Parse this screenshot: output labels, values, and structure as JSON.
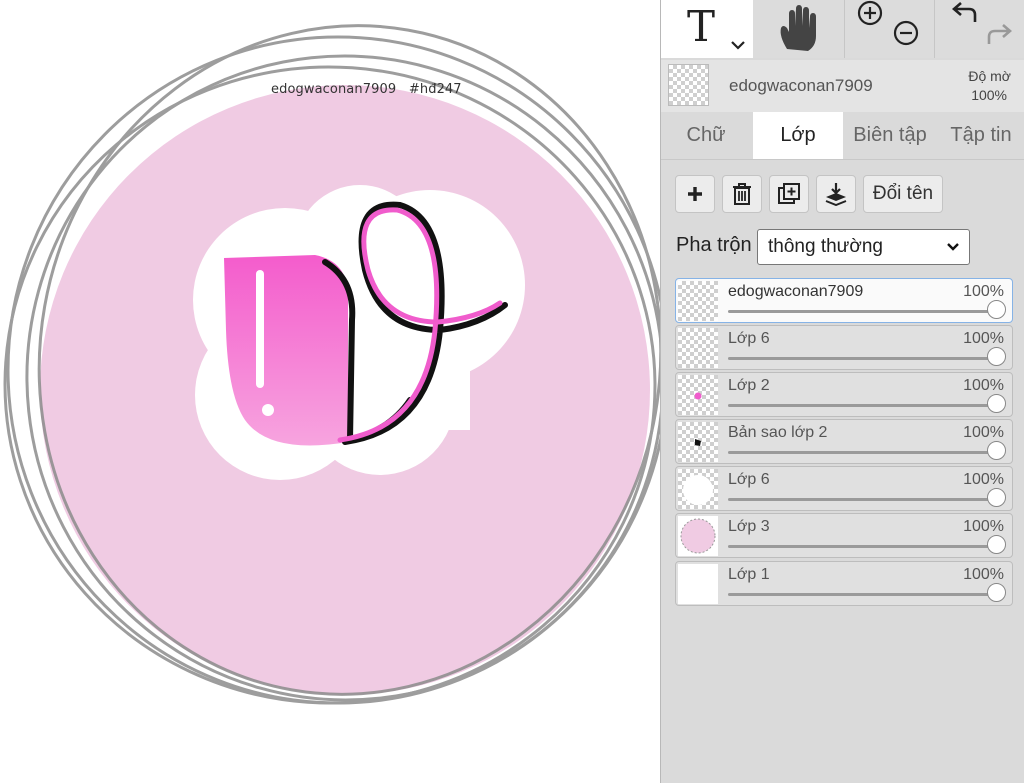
{
  "canvas": {
    "label": "edogwaconan7909   #hđ247",
    "colors": {
      "circle": "#f0cbe3",
      "ring": "#8c8c8c",
      "letter": "#f05ccc",
      "outline": "#111111"
    }
  },
  "toolbar": {
    "tools": [
      {
        "name": "text-tool",
        "glyph": "T",
        "active": true
      },
      {
        "name": "hand-tool",
        "active": false
      },
      {
        "name": "zoom-tool",
        "active": false
      },
      {
        "name": "undo-redo",
        "active": false
      }
    ]
  },
  "layer_header": {
    "name": "edogwaconan7909",
    "opacity_label": "Độ mờ",
    "opacity_value": "100%"
  },
  "tabs": [
    {
      "label": "Chữ",
      "active": false
    },
    {
      "label": "Lớp",
      "active": true
    },
    {
      "label": "Biên tập",
      "active": false
    },
    {
      "label": "Tập tin",
      "active": false
    }
  ],
  "layer_buttons": {
    "icons": [
      "add-icon",
      "trash-icon",
      "duplicate-icon",
      "merge-down-icon"
    ],
    "rename_label": "Đổi tên"
  },
  "blend": {
    "label": "Pha trộn",
    "selected": "thông thường"
  },
  "layers": [
    {
      "name": "edogwaconan7909",
      "opacity": "100%",
      "opacity_value": 1.0,
      "selected": true,
      "thumb": "transparent"
    },
    {
      "name": "Lớp 6",
      "opacity": "100%",
      "opacity_value": 1.0,
      "selected": false,
      "thumb": "transparent"
    },
    {
      "name": "Lớp 2",
      "opacity": "100%",
      "opacity_value": 1.0,
      "selected": false,
      "thumb": "pink-mark"
    },
    {
      "name": "Bản sao lớp 2",
      "opacity": "100%",
      "opacity_value": 1.0,
      "selected": false,
      "thumb": "black-mark"
    },
    {
      "name": "Lớp 6",
      "opacity": "100%",
      "opacity_value": 1.0,
      "selected": false,
      "thumb": "white-circle"
    },
    {
      "name": "Lớp 3",
      "opacity": "100%",
      "opacity_value": 1.0,
      "selected": false,
      "thumb": "pink-circle"
    },
    {
      "name": "Lớp 1",
      "opacity": "100%",
      "opacity_value": 1.0,
      "selected": false,
      "thumb": "white"
    }
  ]
}
